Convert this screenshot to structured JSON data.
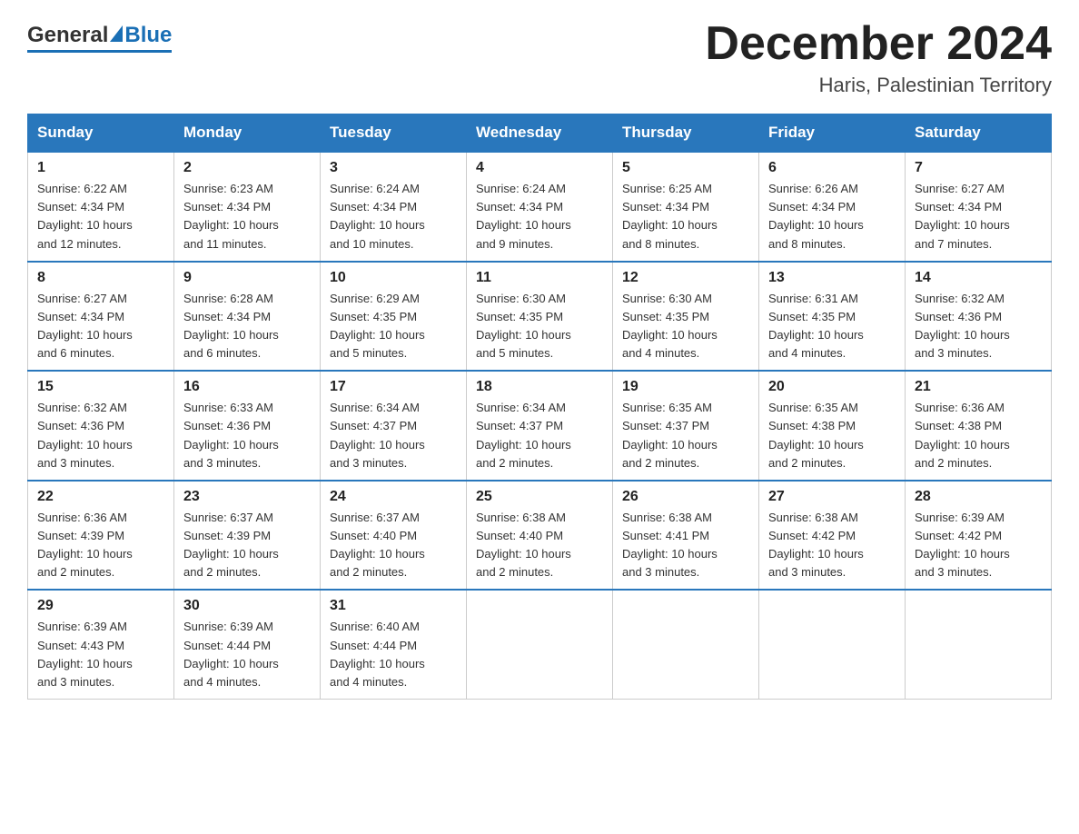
{
  "header": {
    "logo_general": "General",
    "logo_blue": "Blue",
    "month_title": "December 2024",
    "location": "Haris, Palestinian Territory"
  },
  "days_of_week": [
    "Sunday",
    "Monday",
    "Tuesday",
    "Wednesday",
    "Thursday",
    "Friday",
    "Saturday"
  ],
  "weeks": [
    [
      {
        "day": "1",
        "sunrise": "6:22 AM",
        "sunset": "4:34 PM",
        "daylight": "10 hours and 12 minutes."
      },
      {
        "day": "2",
        "sunrise": "6:23 AM",
        "sunset": "4:34 PM",
        "daylight": "10 hours and 11 minutes."
      },
      {
        "day": "3",
        "sunrise": "6:24 AM",
        "sunset": "4:34 PM",
        "daylight": "10 hours and 10 minutes."
      },
      {
        "day": "4",
        "sunrise": "6:24 AM",
        "sunset": "4:34 PM",
        "daylight": "10 hours and 9 minutes."
      },
      {
        "day": "5",
        "sunrise": "6:25 AM",
        "sunset": "4:34 PM",
        "daylight": "10 hours and 8 minutes."
      },
      {
        "day": "6",
        "sunrise": "6:26 AM",
        "sunset": "4:34 PM",
        "daylight": "10 hours and 8 minutes."
      },
      {
        "day": "7",
        "sunrise": "6:27 AM",
        "sunset": "4:34 PM",
        "daylight": "10 hours and 7 minutes."
      }
    ],
    [
      {
        "day": "8",
        "sunrise": "6:27 AM",
        "sunset": "4:34 PM",
        "daylight": "10 hours and 6 minutes."
      },
      {
        "day": "9",
        "sunrise": "6:28 AM",
        "sunset": "4:34 PM",
        "daylight": "10 hours and 6 minutes."
      },
      {
        "day": "10",
        "sunrise": "6:29 AM",
        "sunset": "4:35 PM",
        "daylight": "10 hours and 5 minutes."
      },
      {
        "day": "11",
        "sunrise": "6:30 AM",
        "sunset": "4:35 PM",
        "daylight": "10 hours and 5 minutes."
      },
      {
        "day": "12",
        "sunrise": "6:30 AM",
        "sunset": "4:35 PM",
        "daylight": "10 hours and 4 minutes."
      },
      {
        "day": "13",
        "sunrise": "6:31 AM",
        "sunset": "4:35 PM",
        "daylight": "10 hours and 4 minutes."
      },
      {
        "day": "14",
        "sunrise": "6:32 AM",
        "sunset": "4:36 PM",
        "daylight": "10 hours and 3 minutes."
      }
    ],
    [
      {
        "day": "15",
        "sunrise": "6:32 AM",
        "sunset": "4:36 PM",
        "daylight": "10 hours and 3 minutes."
      },
      {
        "day": "16",
        "sunrise": "6:33 AM",
        "sunset": "4:36 PM",
        "daylight": "10 hours and 3 minutes."
      },
      {
        "day": "17",
        "sunrise": "6:34 AM",
        "sunset": "4:37 PM",
        "daylight": "10 hours and 3 minutes."
      },
      {
        "day": "18",
        "sunrise": "6:34 AM",
        "sunset": "4:37 PM",
        "daylight": "10 hours and 2 minutes."
      },
      {
        "day": "19",
        "sunrise": "6:35 AM",
        "sunset": "4:37 PM",
        "daylight": "10 hours and 2 minutes."
      },
      {
        "day": "20",
        "sunrise": "6:35 AM",
        "sunset": "4:38 PM",
        "daylight": "10 hours and 2 minutes."
      },
      {
        "day": "21",
        "sunrise": "6:36 AM",
        "sunset": "4:38 PM",
        "daylight": "10 hours and 2 minutes."
      }
    ],
    [
      {
        "day": "22",
        "sunrise": "6:36 AM",
        "sunset": "4:39 PM",
        "daylight": "10 hours and 2 minutes."
      },
      {
        "day": "23",
        "sunrise": "6:37 AM",
        "sunset": "4:39 PM",
        "daylight": "10 hours and 2 minutes."
      },
      {
        "day": "24",
        "sunrise": "6:37 AM",
        "sunset": "4:40 PM",
        "daylight": "10 hours and 2 minutes."
      },
      {
        "day": "25",
        "sunrise": "6:38 AM",
        "sunset": "4:40 PM",
        "daylight": "10 hours and 2 minutes."
      },
      {
        "day": "26",
        "sunrise": "6:38 AM",
        "sunset": "4:41 PM",
        "daylight": "10 hours and 3 minutes."
      },
      {
        "day": "27",
        "sunrise": "6:38 AM",
        "sunset": "4:42 PM",
        "daylight": "10 hours and 3 minutes."
      },
      {
        "day": "28",
        "sunrise": "6:39 AM",
        "sunset": "4:42 PM",
        "daylight": "10 hours and 3 minutes."
      }
    ],
    [
      {
        "day": "29",
        "sunrise": "6:39 AM",
        "sunset": "4:43 PM",
        "daylight": "10 hours and 3 minutes."
      },
      {
        "day": "30",
        "sunrise": "6:39 AM",
        "sunset": "4:44 PM",
        "daylight": "10 hours and 4 minutes."
      },
      {
        "day": "31",
        "sunrise": "6:40 AM",
        "sunset": "4:44 PM",
        "daylight": "10 hours and 4 minutes."
      },
      null,
      null,
      null,
      null
    ]
  ],
  "labels": {
    "sunrise": "Sunrise:",
    "sunset": "Sunset:",
    "daylight": "Daylight:"
  }
}
